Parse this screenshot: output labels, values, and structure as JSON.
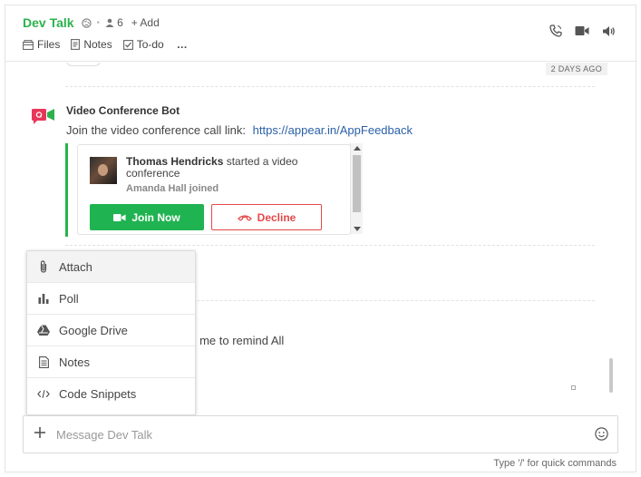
{
  "channel": {
    "title": "Dev Talk",
    "member_count": "6",
    "add_label": "+ Add"
  },
  "tabs": [
    {
      "label": "Files",
      "icon": "files-icon"
    },
    {
      "label": "Notes",
      "icon": "notes-icon"
    },
    {
      "label": "To-do",
      "icon": "todo-icon"
    }
  ],
  "more_label": "…",
  "date_badge": "2 DAYS AGO",
  "bot_message": {
    "sender": "Video Conference Bot",
    "text": "Join the video conference call link:",
    "link": "https://appear.in/AppFeedback"
  },
  "call_card": {
    "caller": "Thomas Hendricks",
    "action": "started a video conference",
    "joined": "Amanda Hall joined",
    "join_label": "Join Now",
    "decline_label": "Decline"
  },
  "remind_text": "ed me to remind All",
  "attach_menu": [
    {
      "label": "Attach",
      "icon": "paperclip-icon"
    },
    {
      "label": "Poll",
      "icon": "poll-icon"
    },
    {
      "label": "Google Drive",
      "icon": "google-drive-icon"
    },
    {
      "label": "Notes",
      "icon": "notes-icon"
    },
    {
      "label": "Code Snippets",
      "icon": "code-icon"
    }
  ],
  "composer": {
    "placeholder": "Message Dev Talk",
    "hint": "Type '/' for quick commands"
  },
  "colors": {
    "accent": "#2bb24c",
    "join": "#20b351",
    "decline": "#e54848",
    "link": "#2a60a8"
  }
}
